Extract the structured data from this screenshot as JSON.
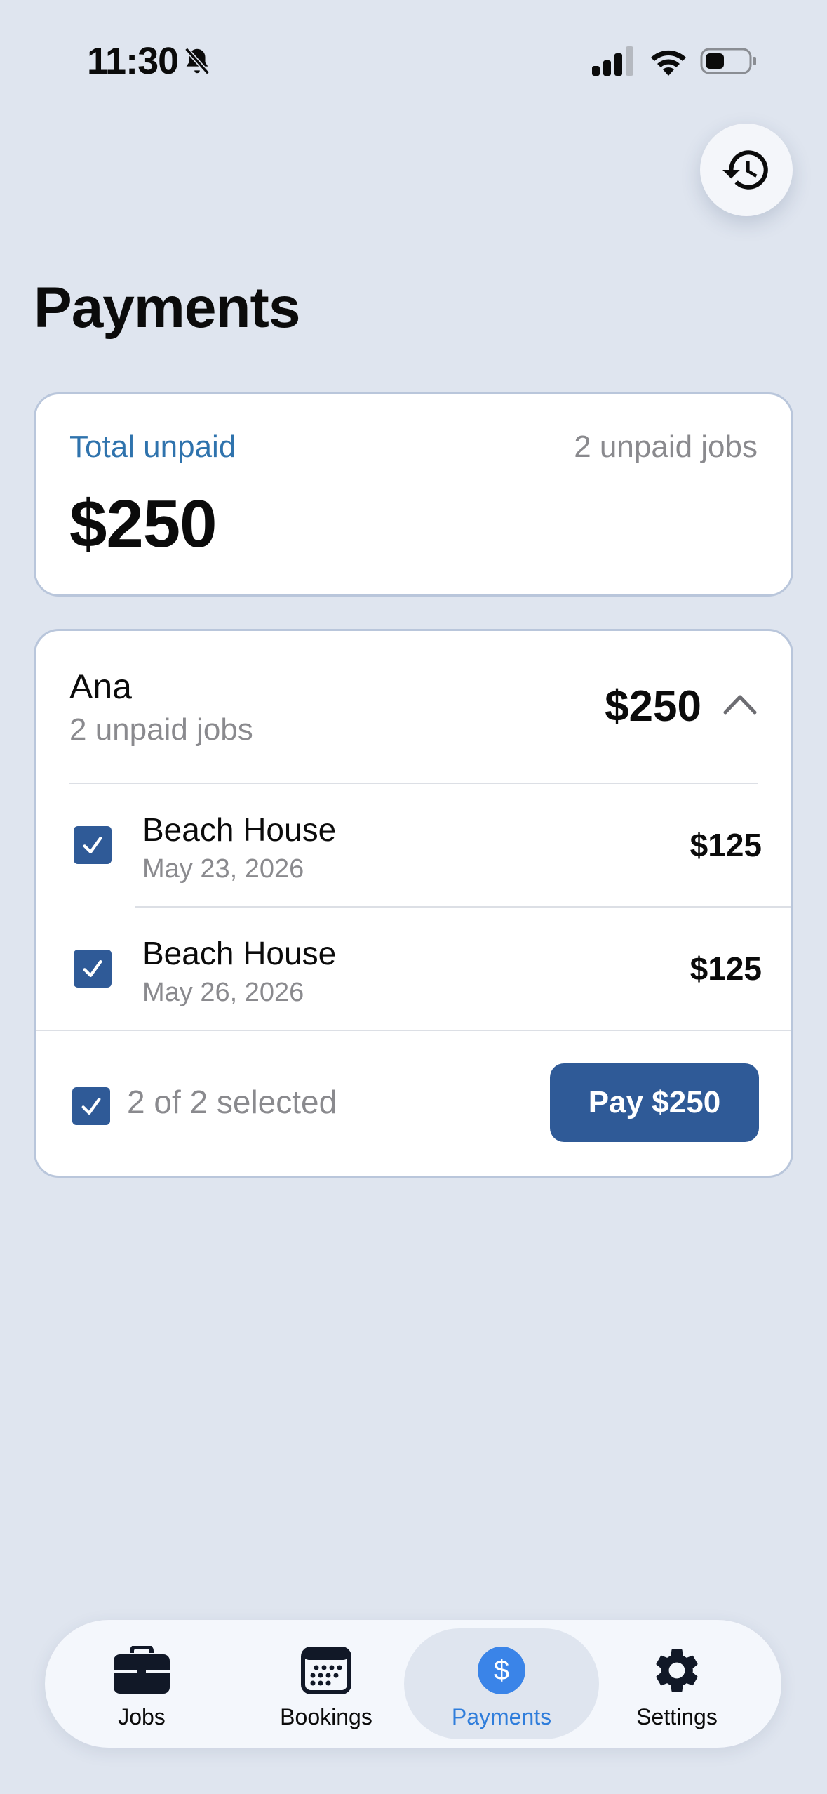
{
  "status_bar": {
    "time": "11:30"
  },
  "header": {
    "title": "Payments"
  },
  "summary": {
    "label": "Total unpaid",
    "count": "2 unpaid jobs",
    "amount": "$250"
  },
  "client": {
    "name": "Ana",
    "subtitle": "2 unpaid jobs",
    "total": "$250",
    "jobs": [
      {
        "title": "Beach House",
        "date": "May 23, 2026",
        "amount": "$125",
        "checked": true
      },
      {
        "title": "Beach House",
        "date": "May 26, 2026",
        "amount": "$125",
        "checked": true
      }
    ],
    "selection_text": "2 of 2 selected",
    "pay_label": "Pay $250"
  },
  "tabs": [
    {
      "label": "Jobs",
      "icon": "briefcase-icon"
    },
    {
      "label": "Bookings",
      "icon": "calendar-icon"
    },
    {
      "label": "Payments",
      "icon": "dollar-icon",
      "active": true
    },
    {
      "label": "Settings",
      "icon": "gear-icon"
    }
  ],
  "colors": {
    "background": "#dfe5ef",
    "accent": "#2f5a97",
    "active_tab": "#3a84e8",
    "label_blue": "#2f73ad"
  }
}
